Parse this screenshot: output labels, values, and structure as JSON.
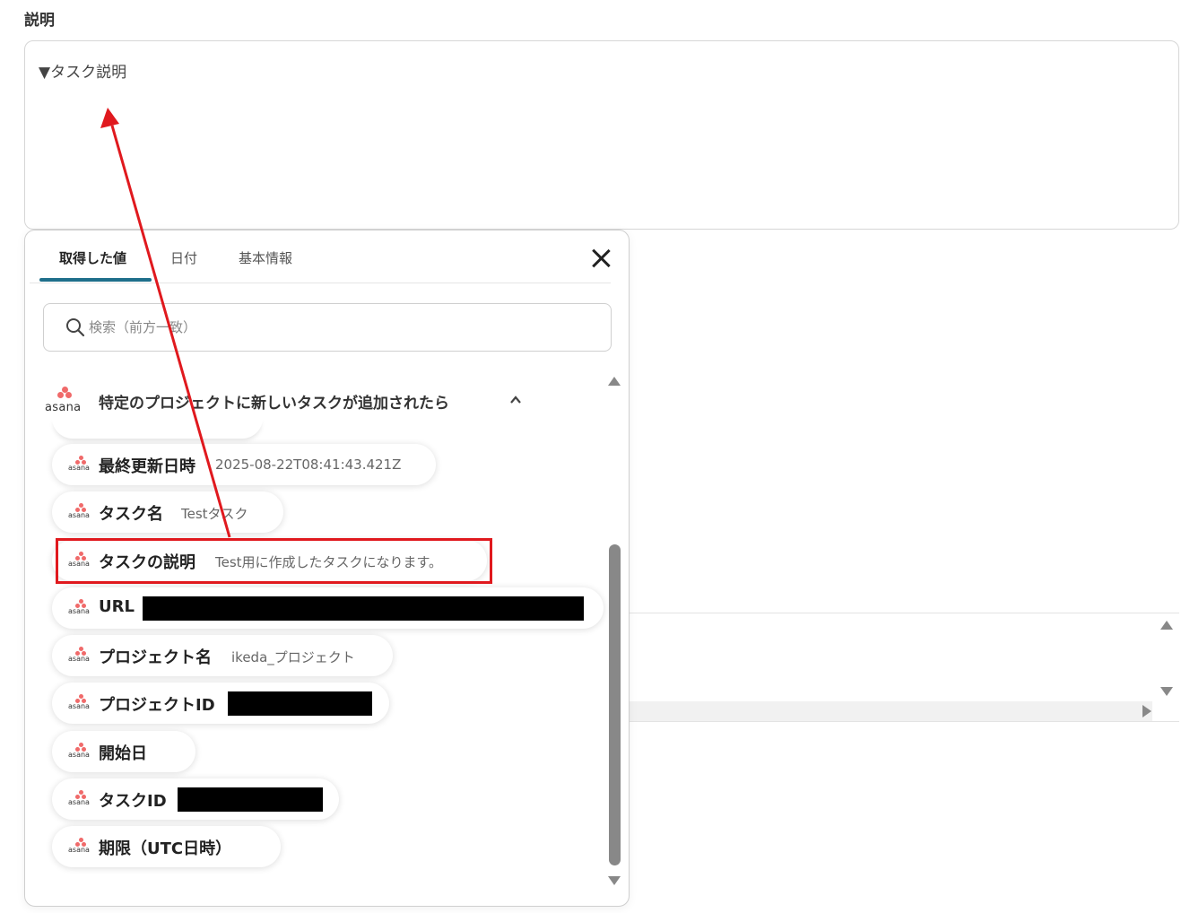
{
  "field": {
    "label": "説明",
    "description_value": "▼タスク説明"
  },
  "panel": {
    "tabs": [
      {
        "label": "取得した値",
        "active": true
      },
      {
        "label": "日付",
        "active": false
      },
      {
        "label": "基本情報",
        "active": false
      }
    ],
    "search": {
      "placeholder": "検索（前方一致）",
      "value": ""
    },
    "group": {
      "logo_text": "asana",
      "title": "特定のプロジェクトに新しいタスクが追加されたら",
      "expanded": true
    },
    "items": [
      {
        "logo_text": "asana",
        "label": "最終更新日時",
        "value": "2025-08-22T08:41:43.421Z"
      },
      {
        "logo_text": "asana",
        "label": "タスク名",
        "value": "Testタスク"
      },
      {
        "logo_text": "asana",
        "label": "タスクの説明",
        "value": "Test用に作成したタスクになります。",
        "highlighted": true
      },
      {
        "logo_text": "asana",
        "label": "URL",
        "value": "",
        "redacted": true
      },
      {
        "logo_text": "asana",
        "label": "プロジェクト名",
        "value": "ikeda_プロジェクト"
      },
      {
        "logo_text": "asana",
        "label": "プロジェクトID",
        "value": "",
        "redacted": true
      },
      {
        "logo_text": "asana",
        "label": "開始日",
        "value": ""
      },
      {
        "logo_text": "asana",
        "label": "タスクID",
        "value": "",
        "redacted": true
      },
      {
        "logo_text": "asana",
        "label": "期限（UTC日時）",
        "value": ""
      }
    ]
  },
  "colors": {
    "accent_tab": "#1f6f8b",
    "asana_brand": "#f06a6a",
    "annotation_red": "#e0191e"
  },
  "icons": {
    "search": "search-icon",
    "close": "close-icon",
    "collapse": "chevron-up-icon",
    "brand": "asana-logo-icon"
  }
}
